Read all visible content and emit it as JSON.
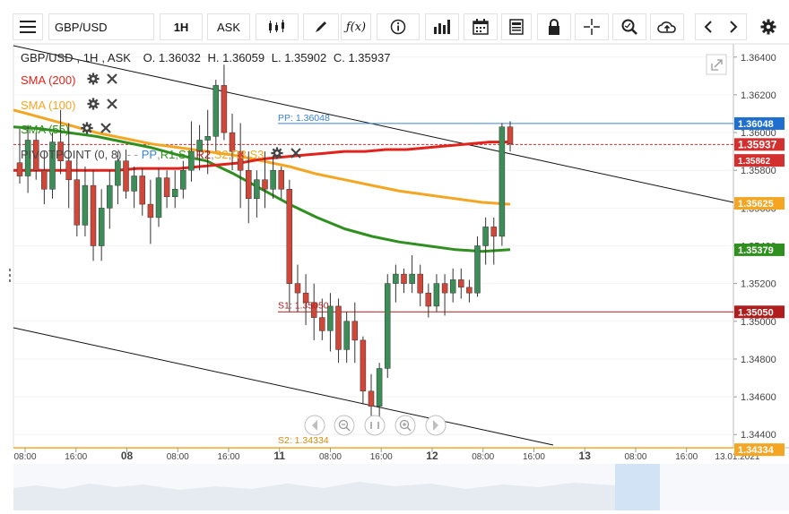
{
  "toolbar": {
    "symbol": "GBP/USD",
    "timeframe": "1H",
    "price_type": "ASK"
  },
  "ohlc": {
    "pair": "GBP/USD",
    "timeframe": "1H",
    "side": "ASK",
    "open": "O. 1.36032",
    "high": "H. 1.36059",
    "low": "L. 1.35902",
    "close": "C. 1.35937"
  },
  "legend": {
    "sma200": "SMA (200)",
    "sma100": "SMA (100)",
    "sma55": "SMA (55)",
    "pivot_name": "PIVOTPOINT (0, 8)",
    "pivot_levels": [
      "PP",
      "R1",
      "S1",
      "R2",
      "S2",
      "R3",
      "S3"
    ]
  },
  "colors": {
    "up": "#3d8d58",
    "down": "#d0473a",
    "sma200": "#e0231c",
    "sma100": "#f4a623",
    "sma55": "#2f8f1f",
    "pp": "#3b82d6",
    "s1": "#b11d1d",
    "s2": "#f4a623",
    "price_tag": "#d32f2f",
    "sma100_tag": "#f4a623",
    "sma55_tag": "#2f8f1f",
    "s1_tag": "#b11d1d",
    "pp_tag": "#1f6fd1"
  },
  "price_axis": {
    "labels": [
      "1.36400",
      "1.36200",
      "1.36000",
      "1.35800",
      "1.35600",
      "1.35400",
      "1.35200",
      "1.35000",
      "1.34800",
      "1.34600",
      "1.34400"
    ],
    "tags": {
      "pp": "1.36048",
      "last": "1.35937",
      "sma100": "1.35625",
      "sma55": "1.35379",
      "s1": "1.35050",
      "s2": "1.34334",
      "hidden": "1.35862"
    }
  },
  "time_axis": {
    "labels": [
      "08:00",
      "16:00",
      "08",
      "08:00",
      "16:00",
      "11",
      "08:00",
      "16:00",
      "12",
      "08:00",
      "16:00",
      "13",
      "08:00",
      "16:00",
      "13.01.2021"
    ],
    "bold": [
      "08",
      "11",
      "12",
      "13"
    ]
  },
  "pivot_labels": {
    "pp": "PP: 1.36048",
    "s1": "S1: 1.35050",
    "s2": "S2: 1.34334"
  },
  "chart_data": {
    "type": "candlestick",
    "ylim": [
      1.3433,
      1.3647
    ],
    "candles_ohlc": [
      [
        1.3584,
        1.3602,
        1.3573,
        1.3577
      ],
      [
        1.3577,
        1.3604,
        1.3568,
        1.3596
      ],
      [
        1.3596,
        1.36,
        1.3575,
        1.358
      ],
      [
        1.358,
        1.359,
        1.3562,
        1.357
      ],
      [
        1.357,
        1.36,
        1.3565,
        1.3595
      ],
      [
        1.3595,
        1.3612,
        1.3578,
        1.3585
      ],
      [
        1.3585,
        1.3605,
        1.356,
        1.3575
      ],
      [
        1.3575,
        1.359,
        1.3545,
        1.3551
      ],
      [
        1.3551,
        1.3582,
        1.3545,
        1.3572
      ],
      [
        1.3572,
        1.358,
        1.3532,
        1.354
      ],
      [
        1.354,
        1.357,
        1.3532,
        1.356
      ],
      [
        1.356,
        1.358,
        1.3549,
        1.3572
      ],
      [
        1.3572,
        1.359,
        1.3562,
        1.3585
      ],
      [
        1.3585,
        1.3591,
        1.3565,
        1.3569
      ],
      [
        1.3569,
        1.3582,
        1.356,
        1.3577
      ],
      [
        1.3577,
        1.3581,
        1.3556,
        1.3562
      ],
      [
        1.3562,
        1.3575,
        1.3541,
        1.3555
      ],
      [
        1.3555,
        1.3581,
        1.355,
        1.3576
      ],
      [
        1.3576,
        1.358,
        1.356,
        1.3566
      ],
      [
        1.3566,
        1.358,
        1.356,
        1.357
      ],
      [
        1.357,
        1.3585,
        1.3565,
        1.358
      ],
      [
        1.358,
        1.3606,
        1.3574,
        1.359
      ],
      [
        1.359,
        1.3604,
        1.358,
        1.3596
      ],
      [
        1.3596,
        1.3612,
        1.3578,
        1.3598
      ],
      [
        1.3598,
        1.3628,
        1.359,
        1.3625
      ],
      [
        1.3625,
        1.3636,
        1.3596,
        1.36
      ],
      [
        1.36,
        1.361,
        1.358,
        1.359
      ],
      [
        1.359,
        1.3605,
        1.356,
        1.358
      ],
      [
        1.358,
        1.359,
        1.3552,
        1.3565
      ],
      [
        1.3565,
        1.358,
        1.3555,
        1.3575
      ],
      [
        1.3575,
        1.359,
        1.356,
        1.357
      ],
      [
        1.357,
        1.3588,
        1.3565,
        1.358
      ],
      [
        1.358,
        1.3582,
        1.3565,
        1.357
      ],
      [
        1.357,
        1.3575,
        1.3505,
        1.352
      ],
      [
        1.352,
        1.353,
        1.3505,
        1.3515
      ],
      [
        1.3515,
        1.3525,
        1.3498,
        1.351
      ],
      [
        1.351,
        1.352,
        1.349,
        1.3502
      ],
      [
        1.3502,
        1.3512,
        1.349,
        1.3495
      ],
      [
        1.3495,
        1.3515,
        1.3484,
        1.3508
      ],
      [
        1.3508,
        1.3512,
        1.3478,
        1.3485
      ],
      [
        1.3485,
        1.3505,
        1.3478,
        1.35
      ],
      [
        1.35,
        1.351,
        1.3478,
        1.349
      ],
      [
        1.349,
        1.3492,
        1.3456,
        1.3463
      ],
      [
        1.3463,
        1.3472,
        1.3448,
        1.3455
      ],
      [
        1.3455,
        1.3478,
        1.3448,
        1.3475
      ],
      [
        1.3475,
        1.3525,
        1.347,
        1.352
      ],
      [
        1.352,
        1.353,
        1.351,
        1.3525
      ],
      [
        1.3525,
        1.3528,
        1.3515,
        1.352
      ],
      [
        1.352,
        1.3535,
        1.3515,
        1.3525
      ],
      [
        1.3525,
        1.353,
        1.3508,
        1.3515
      ],
      [
        1.3515,
        1.352,
        1.3502,
        1.3508
      ],
      [
        1.3508,
        1.3525,
        1.3505,
        1.352
      ],
      [
        1.352,
        1.3525,
        1.3503,
        1.3515
      ],
      [
        1.3515,
        1.3528,
        1.351,
        1.3522
      ],
      [
        1.3522,
        1.3528,
        1.3512,
        1.3518
      ],
      [
        1.3518,
        1.3522,
        1.351,
        1.3515
      ],
      [
        1.3515,
        1.3545,
        1.3513,
        1.354
      ],
      [
        1.354,
        1.3555,
        1.353,
        1.355
      ],
      [
        1.355,
        1.3555,
        1.353,
        1.3545
      ],
      [
        1.3545,
        1.3605,
        1.354,
        1.3603
      ],
      [
        1.3603,
        1.3606,
        1.359,
        1.3594
      ]
    ],
    "sma200": [
      1.358,
      1.358,
      1.358,
      1.358,
      1.358,
      1.358,
      1.3581,
      1.3581,
      1.3581,
      1.3582,
      1.3583,
      1.3584,
      1.3586,
      1.3587,
      1.3588,
      1.3589,
      1.359,
      1.359,
      1.3591,
      1.3591,
      1.3592,
      1.3593,
      1.3594,
      1.3595,
      1.3595
    ],
    "sma100": [
      1.3612,
      1.3608,
      1.3604,
      1.36,
      1.3597,
      1.3594,
      1.3592,
      1.359,
      1.3588,
      1.3585,
      1.3582,
      1.3578,
      1.3575,
      1.3572,
      1.3569,
      1.3567,
      1.3565,
      1.3563,
      1.3562
    ],
    "sma55": [
      1.3603,
      1.3602,
      1.36,
      1.3598,
      1.3595,
      1.3592,
      1.3588,
      1.3585,
      1.3578,
      1.357,
      1.3562,
      1.3555,
      1.3549,
      1.3545,
      1.3542,
      1.354,
      1.3538,
      1.3537,
      1.3538
    ],
    "pivot_pp": 1.36048,
    "pivot_s1": 1.3505,
    "pivot_s2": 1.34334,
    "last_price": 1.35937
  }
}
